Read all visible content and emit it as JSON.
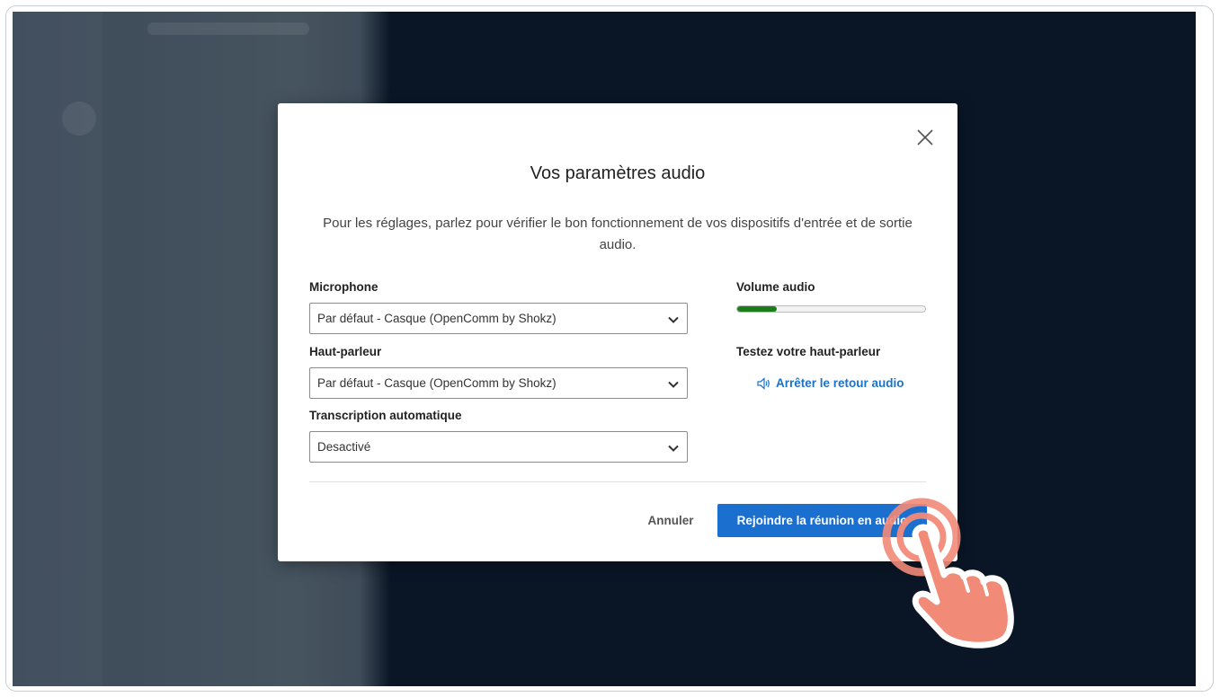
{
  "dialog": {
    "title": "Vos paramètres audio",
    "description": "Pour les réglages, parlez pour vérifier le bon fonctionnement de vos dispositifs d'entrée et de sortie audio.",
    "microphone": {
      "label": "Microphone",
      "value": "Par défaut - Casque (OpenComm by Shokz)"
    },
    "speaker": {
      "label": "Haut-parleur",
      "value": "Par défaut - Casque (OpenComm by Shokz)"
    },
    "transcription": {
      "label": "Transcription automatique",
      "value": "Desactivé"
    },
    "volume": {
      "label": "Volume audio",
      "level_percent": 21
    },
    "speaker_test": {
      "label": "Testez votre haut-parleur",
      "stop_label": "Arrêter le retour audio"
    },
    "cancel_label": "Annuler",
    "join_label": "Rejoindre la réunion en audio"
  },
  "colors": {
    "accent": "#1b6fcf",
    "link": "#1a73c8",
    "volume_fill": "#1a7d1a",
    "backdrop": "#0a1626",
    "cursor_hand": "#f28a78"
  },
  "icons": [
    "close-icon",
    "chevron-down-icon",
    "speaker-icon",
    "pointing-hand-icon"
  ]
}
